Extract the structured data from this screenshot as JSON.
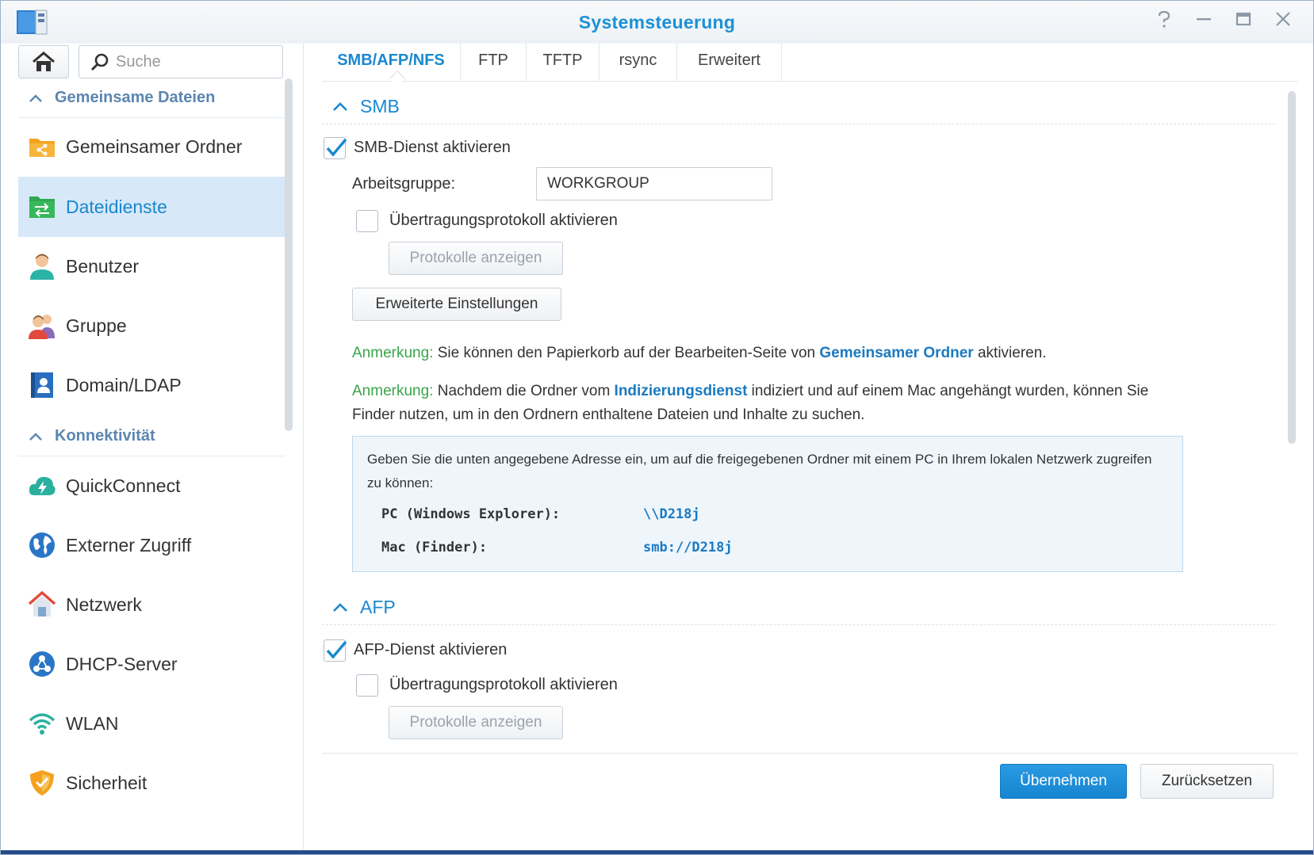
{
  "window": {
    "title": "Systemsteuerung"
  },
  "colors": {
    "accent": "#1a88d0",
    "note_tag": "#39a54a",
    "active_bg": "#d7e8f8"
  },
  "sidebar": {
    "search_placeholder": "Suche",
    "sections": [
      {
        "label": "Gemeinsame Dateien"
      },
      {
        "label": "Konnektivität"
      }
    ],
    "items": [
      {
        "label": "Gemeinsamer Ordner",
        "icon": "shared-folder-icon"
      },
      {
        "label": "Dateidienste",
        "icon": "file-services-icon",
        "active": true
      },
      {
        "label": "Benutzer",
        "icon": "user-icon"
      },
      {
        "label": "Gruppe",
        "icon": "group-icon"
      },
      {
        "label": "Domain/LDAP",
        "icon": "domain-ldap-icon"
      },
      {
        "label": "QuickConnect",
        "icon": "quickconnect-icon"
      },
      {
        "label": "Externer Zugriff",
        "icon": "globe-icon"
      },
      {
        "label": "Netzwerk",
        "icon": "network-house-icon"
      },
      {
        "label": "DHCP-Server",
        "icon": "dhcp-server-icon"
      },
      {
        "label": "WLAN",
        "icon": "wifi-icon"
      },
      {
        "label": "Sicherheit",
        "icon": "shield-icon"
      }
    ]
  },
  "tabs": [
    {
      "label": "SMB/AFP/NFS",
      "active": true
    },
    {
      "label": "FTP"
    },
    {
      "label": "TFTP"
    },
    {
      "label": "rsync"
    },
    {
      "label": "Erweitert"
    }
  ],
  "smb": {
    "heading": "SMB",
    "enable_label": "SMB-Dienst aktivieren",
    "enable_checked": true,
    "workgroup_label": "Arbeitsgruppe:",
    "workgroup_value": "WORKGROUP",
    "log_label": "Übertragungsprotokoll aktivieren",
    "log_checked": false,
    "show_logs_button": "Protokolle anzeigen",
    "advanced_button": "Erweiterte Einstellungen",
    "note1": {
      "tag": "Anmerkung:",
      "before": " Sie können den Papierkorb auf der Bearbeiten-Seite von ",
      "link": "Gemeinsamer Ordner",
      "after": " aktivieren."
    },
    "note2": {
      "tag": "Anmerkung:",
      "before": " Nachdem die Ordner vom ",
      "link": "Indizierungsdienst",
      "after": " indiziert und auf einem Mac angehängt wurden, können Sie",
      "line2": "Finder nutzen, um in den Ordnern enthaltene Dateien und Inhalte zu suchen."
    },
    "info": {
      "description": "Geben Sie die unten angegebene Adresse ein, um auf die freigegebenen Ordner mit einem PC in Ihrem lokalen Netzwerk zugreifen zu können:",
      "pc_label": "PC (Windows Explorer):",
      "pc_value": "\\\\D218j",
      "mac_label": "Mac (Finder):",
      "mac_value": "smb://D218j"
    }
  },
  "afp": {
    "heading": "AFP",
    "enable_label": "AFP-Dienst aktivieren",
    "enable_checked": true,
    "log_label": "Übertragungsprotokoll aktivieren",
    "log_checked": false,
    "show_logs_button": "Protokolle anzeigen"
  },
  "footer": {
    "apply_button": "Übernehmen",
    "reset_button": "Zurücksetzen"
  }
}
